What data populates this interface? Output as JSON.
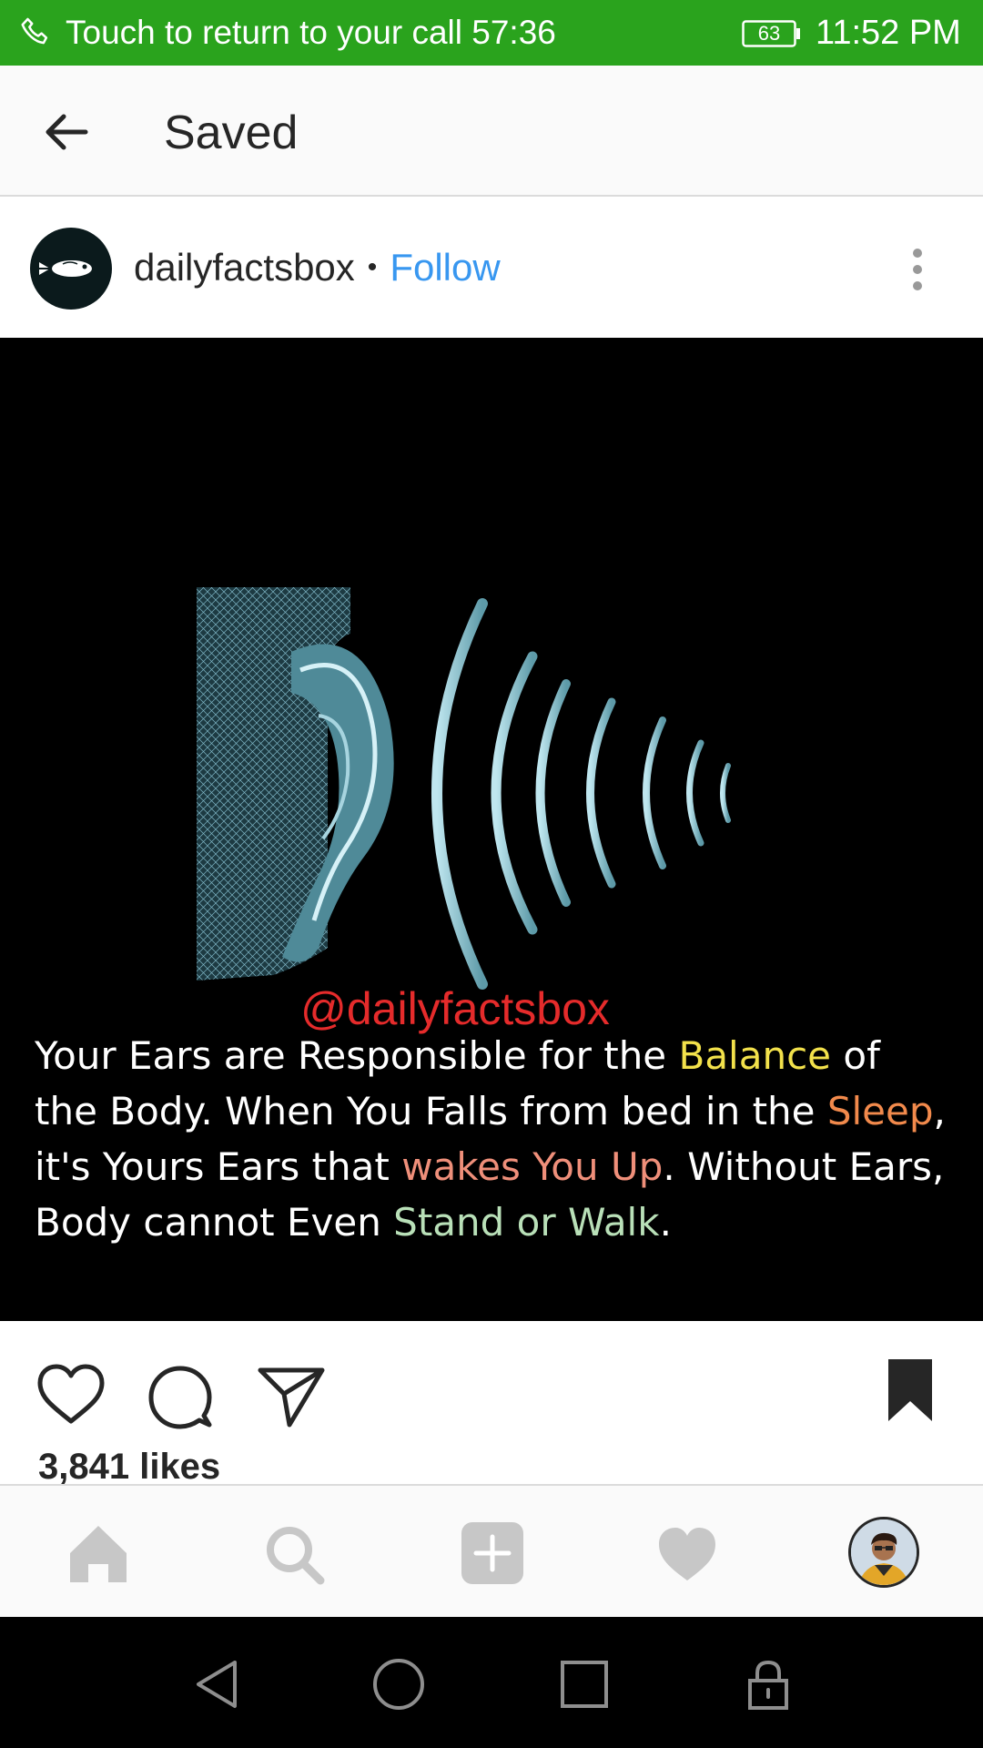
{
  "status_bar": {
    "call_text": "Touch to return to your call 57:36",
    "battery": "63",
    "time": "11:52 PM"
  },
  "header": {
    "title": "Saved"
  },
  "post": {
    "username": "dailyfactsbox",
    "separator": "•",
    "follow_label": "Follow",
    "image": {
      "watermark": "@dailyfactsbox",
      "caption_parts": [
        {
          "text": "Your Ears are Responsible for the ",
          "color": "#ffffff"
        },
        {
          "text": "Balance",
          "color": "#f2e14b"
        },
        {
          "text": " of the Body. When You Falls from bed in the ",
          "color": "#ffffff"
        },
        {
          "text": "Sleep",
          "color": "#f28a4c"
        },
        {
          "text": ", it's Yours Ears that ",
          "color": "#ffffff"
        },
        {
          "text": "wakes You Up",
          "color": "#ef8f7a"
        },
        {
          "text": ". Without Ears, Body cannot Even ",
          "color": "#ffffff"
        },
        {
          "text": "Stand or Walk",
          "color": "#b9e0b8"
        },
        {
          "text": ".",
          "color": "#ffffff"
        }
      ]
    },
    "likes": "3,841 likes"
  },
  "colors": {
    "status_bar_bg": "#2aa31d",
    "link_blue": "#3897f0",
    "watermark_red": "#e52b2b"
  },
  "icons": {
    "status": [
      "phone-icon",
      "battery-icon"
    ],
    "header": [
      "back-arrow-icon"
    ],
    "post": [
      "more-options-icon",
      "heart-icon",
      "comment-icon",
      "share-icon",
      "bookmark-icon"
    ],
    "bottom_nav": [
      "home-icon",
      "search-icon",
      "add-post-icon",
      "activity-heart-icon",
      "profile-avatar"
    ],
    "system_nav": [
      "back-triangle-icon",
      "home-circle-icon",
      "recents-square-icon",
      "lock-icon"
    ]
  }
}
